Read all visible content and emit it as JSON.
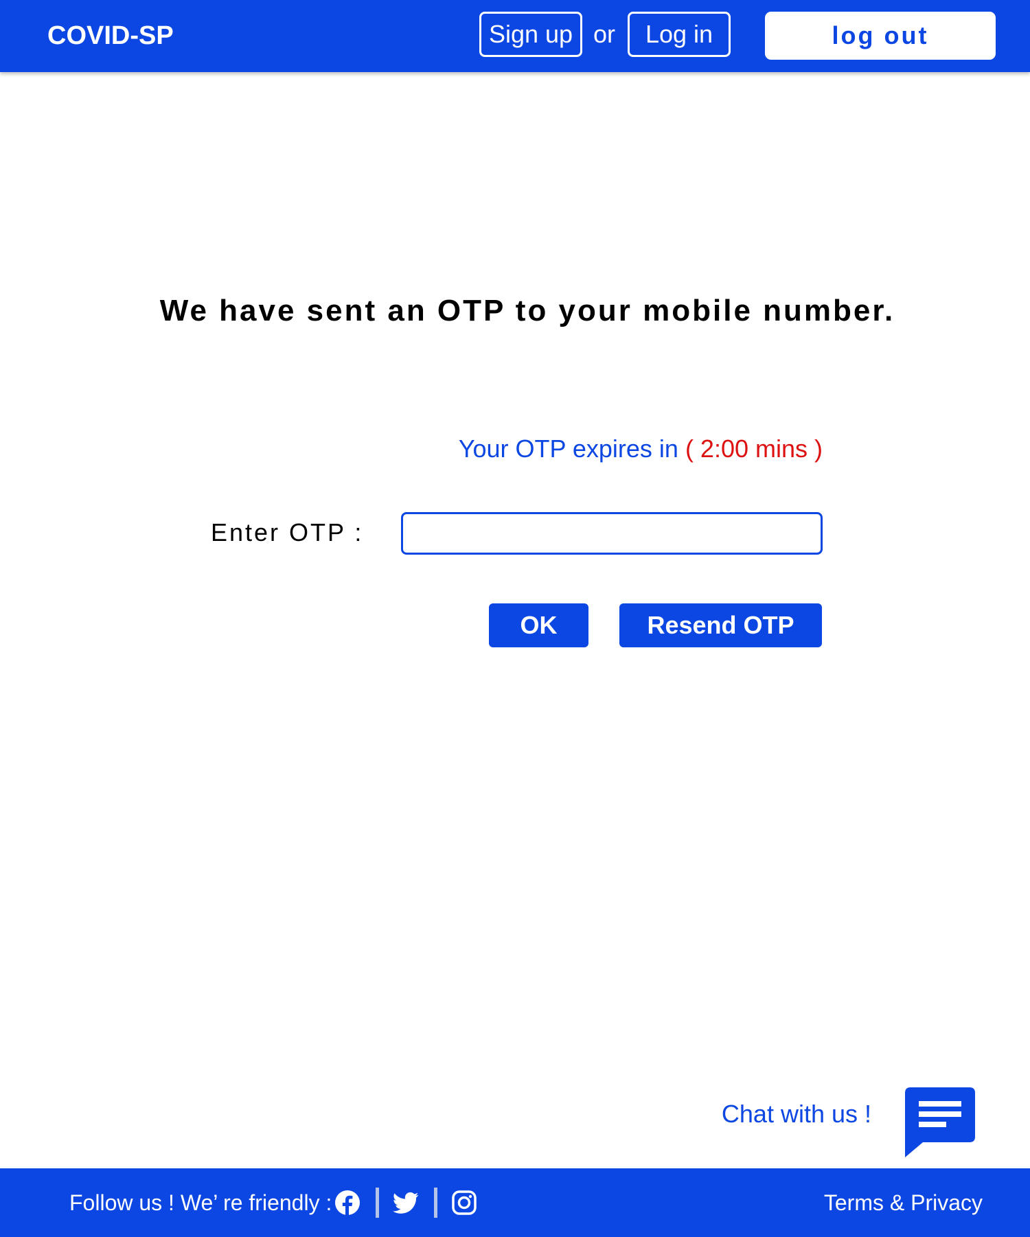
{
  "header": {
    "brand": "COVID-SP",
    "signup_label": "Sign up",
    "or_text": "or",
    "login_label": "Log in",
    "logout_label": "log out"
  },
  "main": {
    "heading": "We have sent an OTP to your mobile number.",
    "timer_prefix": "Your OTP expires in",
    "timer_value": "( 2:00 mins )",
    "otp_label": "Enter OTP :",
    "otp_value": "",
    "ok_label": "OK",
    "resend_label": "Resend OTP"
  },
  "chat": {
    "label": "Chat with us !",
    "icon": "chat-icon"
  },
  "footer": {
    "follow_text": "Follow us !  We’ re friendly :",
    "social_icons": [
      "facebook-icon",
      "twitter-icon",
      "instagram-icon"
    ],
    "terms_label": "Terms & Privacy"
  },
  "colors": {
    "brand_blue": "#0d47e3",
    "timer_red": "#dd1111",
    "text_black": "#000000",
    "background": "#ffffff"
  }
}
